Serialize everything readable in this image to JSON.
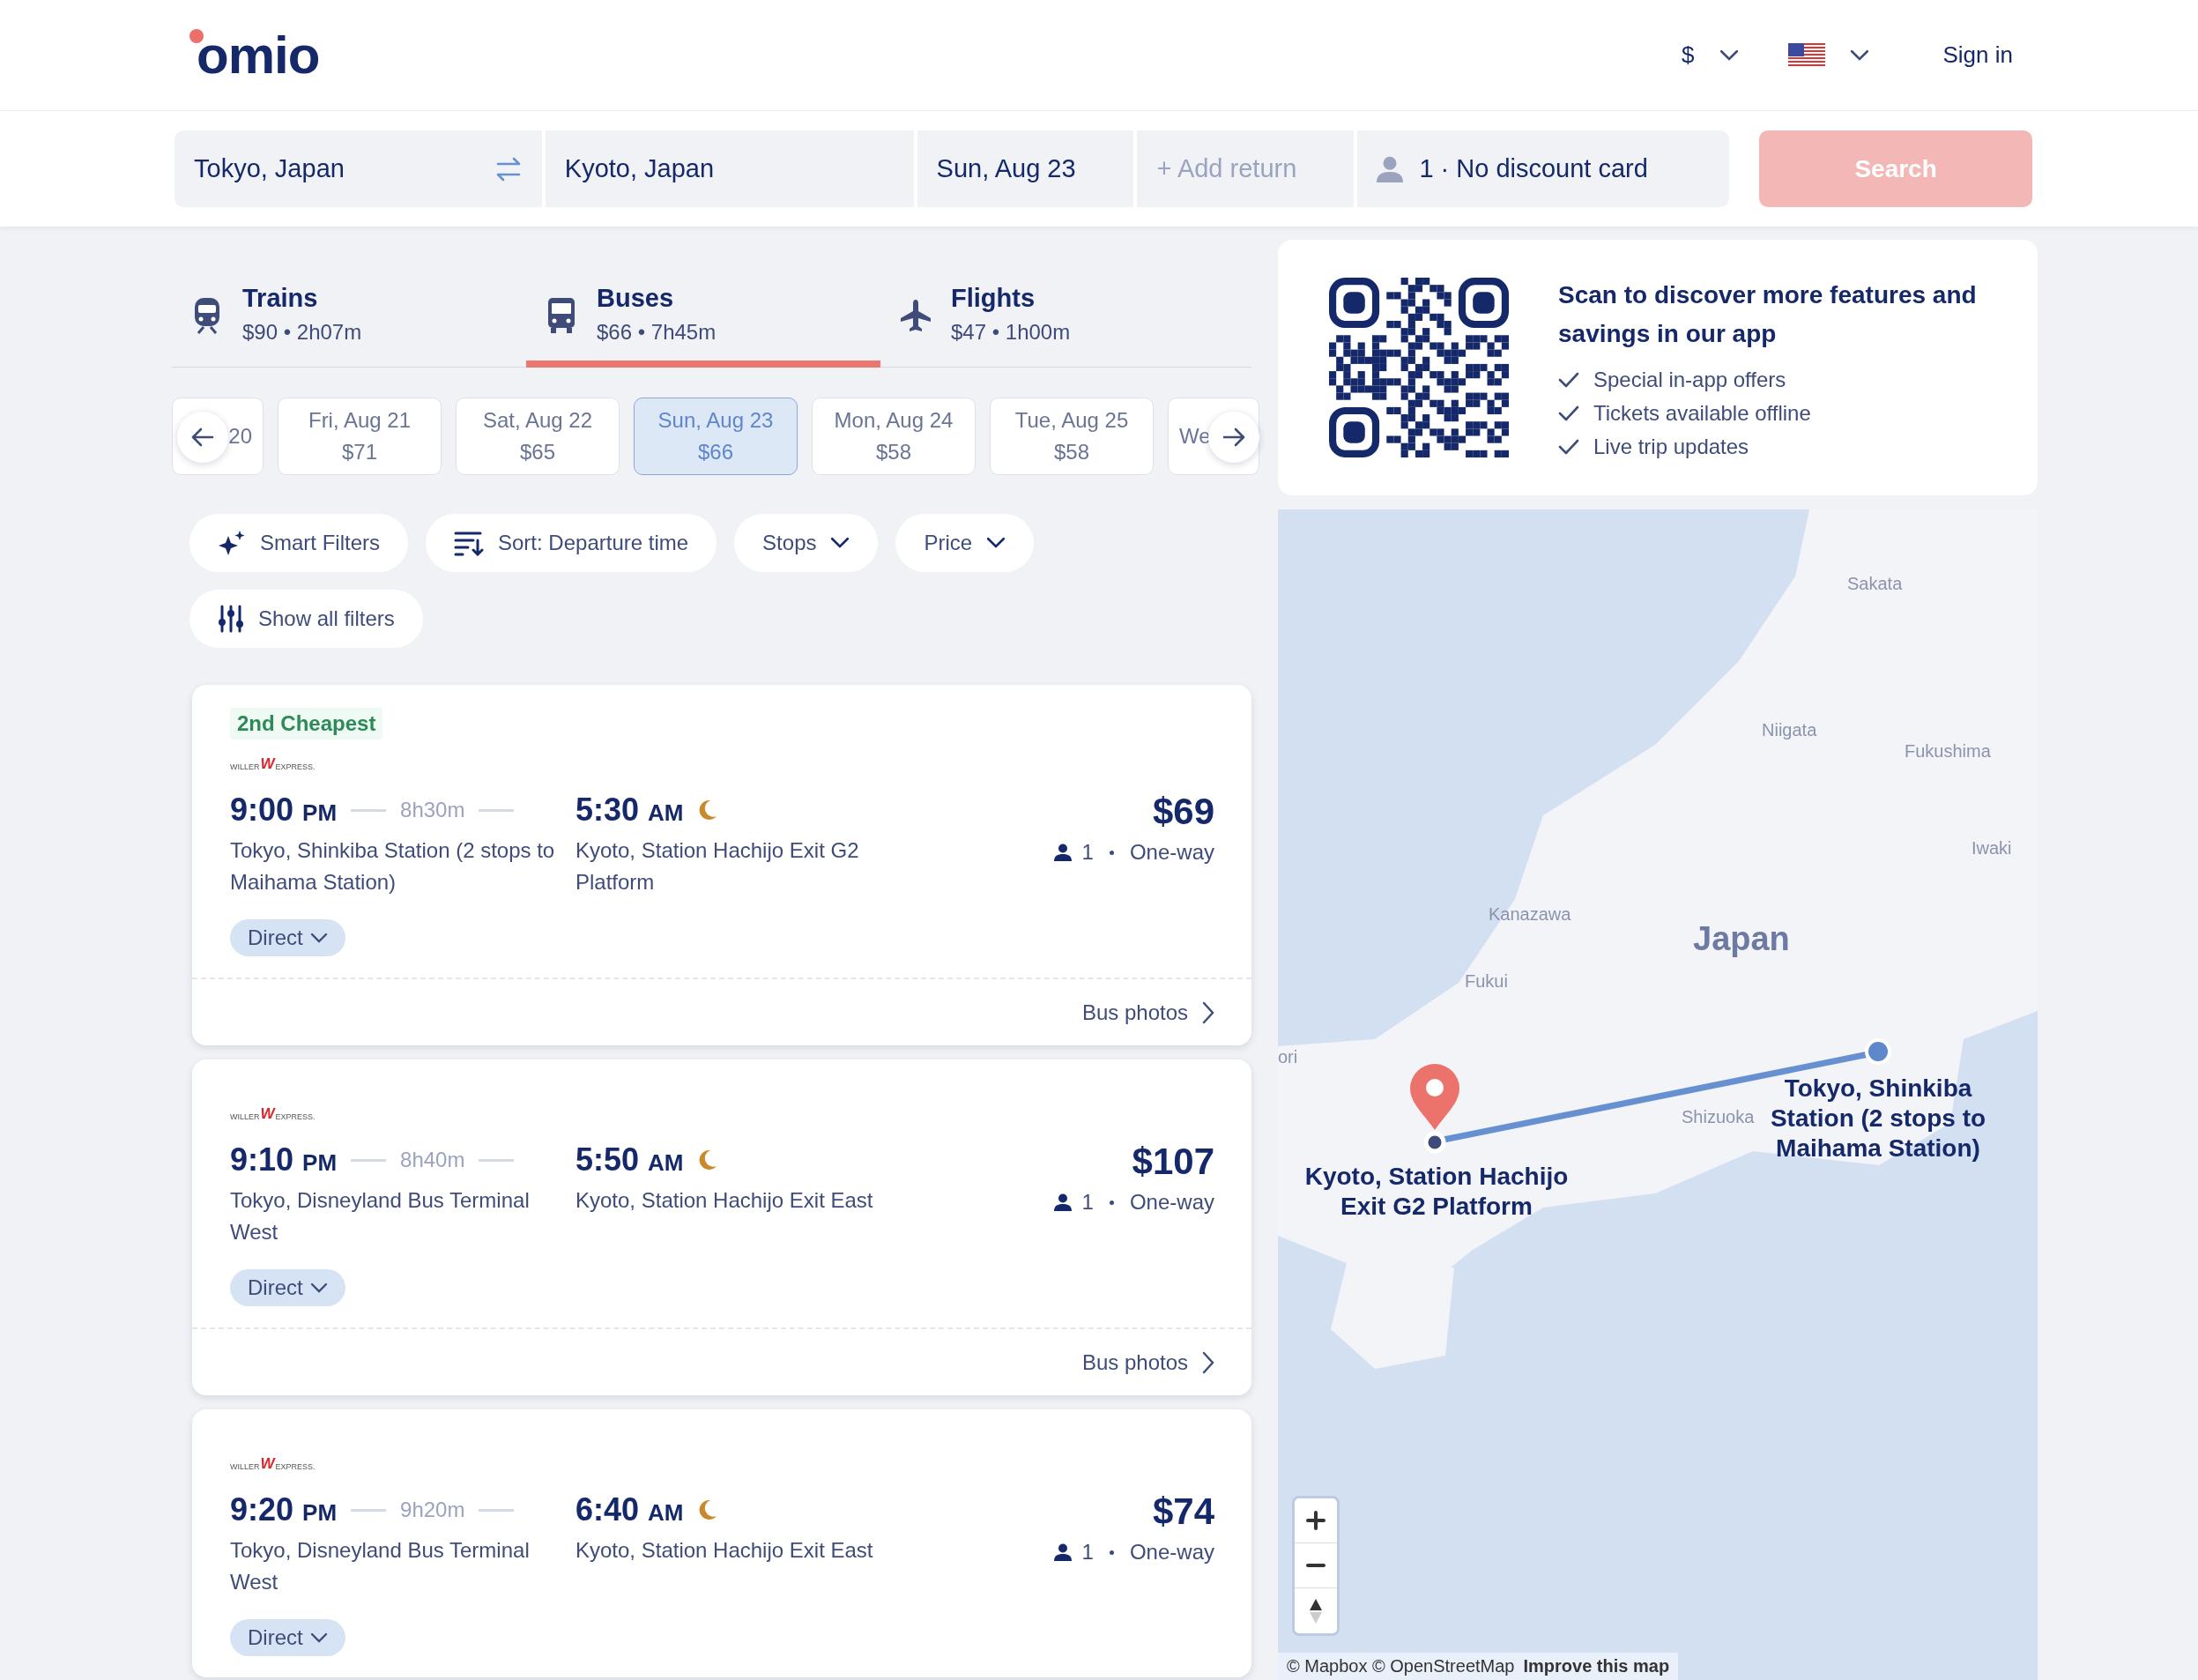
{
  "header": {
    "logo": "omio",
    "currency": "$",
    "sign_in": "Sign in"
  },
  "search": {
    "from": "Tokyo, Japan",
    "to": "Kyoto, Japan",
    "date": "Sun, Aug 23",
    "return_placeholder": "+ Add return",
    "passengers": "1 · No discount card",
    "button": "Search"
  },
  "modes": [
    {
      "kind": "train",
      "label": "Trains",
      "summary": "$90 • 2h07m",
      "selected": false
    },
    {
      "kind": "bus",
      "label": "Buses",
      "summary": "$66 • 7h45m",
      "selected": true
    },
    {
      "kind": "flight",
      "label": "Flights",
      "summary": "$47 • 1h00m",
      "selected": false
    }
  ],
  "dates": [
    {
      "kind": "partial_start",
      "label": "20",
      "selected": false
    },
    {
      "kind": "full",
      "label": "Fri, Aug 21",
      "price": "$71",
      "selected": false
    },
    {
      "kind": "full",
      "label": "Sat, Aug 22",
      "price": "$65",
      "selected": false
    },
    {
      "kind": "full",
      "label": "Sun, Aug 23",
      "price": "$66",
      "selected": true
    },
    {
      "kind": "full",
      "label": "Mon, Aug 24",
      "price": "$58",
      "selected": false
    },
    {
      "kind": "full",
      "label": "Tue, Aug 25",
      "price": "$58",
      "selected": false
    },
    {
      "kind": "partial_end",
      "label": "We",
      "selected": false
    }
  ],
  "filters": [
    {
      "kind": "smart",
      "label": "Smart Filters"
    },
    {
      "kind": "sort",
      "label": "Sort: Departure time"
    },
    {
      "kind": "dropdown",
      "label": "Stops"
    },
    {
      "kind": "dropdown",
      "label": "Price"
    },
    {
      "kind": "all",
      "label": "Show all filters"
    }
  ],
  "results": [
    {
      "badge": "2nd Cheapest",
      "operator": {
        "left": "WILLER",
        "mark": "W",
        "right": "EXPRESS."
      },
      "departure_time": "9:00",
      "departure_period": "PM",
      "duration": "8h30m",
      "arrival_time": "5:30",
      "arrival_period": "AM",
      "overnight": true,
      "from": "Tokyo, Shinkiba Station (2 stops to Maihama Station)",
      "to": "Kyoto, Station Hachijo Exit G2 Platform",
      "price": "$69",
      "passengers": "1",
      "trip": "One-way",
      "stops": "Direct",
      "footer": "Bus photos"
    },
    {
      "operator": {
        "left": "WILLER",
        "mark": "W",
        "right": "EXPRESS."
      },
      "departure_time": "9:10",
      "departure_period": "PM",
      "duration": "8h40m",
      "arrival_time": "5:50",
      "arrival_period": "AM",
      "overnight": true,
      "from": "Tokyo, Disneyland Bus Terminal West",
      "to": "Kyoto, Station Hachijo Exit East",
      "price": "$107",
      "passengers": "1",
      "trip": "One-way",
      "stops": "Direct",
      "footer": "Bus photos"
    },
    {
      "operator": {
        "left": "WILLER",
        "mark": "W",
        "right": "EXPRESS."
      },
      "departure_time": "9:20",
      "departure_period": "PM",
      "duration": "9h20m",
      "arrival_time": "6:40",
      "arrival_period": "AM",
      "overnight": true,
      "from": "Tokyo, Disneyland Bus Terminal West",
      "to": "Kyoto, Station Hachijo Exit East",
      "price": "$74",
      "passengers": "1",
      "trip": "One-way",
      "stops": "Direct"
    }
  ],
  "app_promo": {
    "title": "Scan to discover more features and savings in our app",
    "features": [
      "Special in-app offers",
      "Tickets available offline",
      "Live trip updates"
    ]
  },
  "map": {
    "labels": [
      {
        "kind": "city",
        "text": "Sakata"
      },
      {
        "kind": "city",
        "text": "Niigata"
      },
      {
        "kind": "city",
        "text": "Fukushima"
      },
      {
        "kind": "city",
        "text": "Iwaki"
      },
      {
        "kind": "city",
        "text": "Kanazawa"
      },
      {
        "kind": "country",
        "text": "Japan"
      },
      {
        "kind": "city",
        "text": "Fukui"
      },
      {
        "kind": "city",
        "text": "ori"
      },
      {
        "kind": "city",
        "text": "Shizuoka"
      }
    ],
    "destination": "Kyoto, Station Hachijo Exit G2 Platform",
    "origin": "Tokyo, Shinkiba Station (2 stops to Maihama Station)",
    "attribution": "© Mapbox © OpenStreetMap",
    "improve_link": "Improve this map"
  }
}
